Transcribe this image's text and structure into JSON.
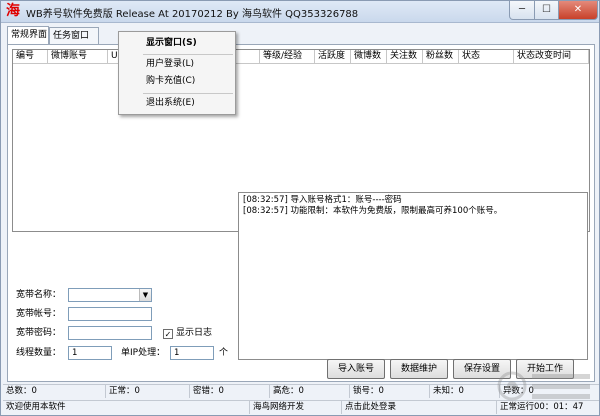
{
  "window": {
    "icon_glyph": "海",
    "title": "WB养号软件免费版 Release At 20170212 By 海鸟软件 QQ353326788",
    "minimize_glyph": "─",
    "maximize_glyph": "☐",
    "close_glyph": "✕"
  },
  "tabs": [
    {
      "label": "常规界面",
      "active": true
    },
    {
      "label": "任务窗口",
      "active": false
    }
  ],
  "table": {
    "columns": [
      "编号",
      "微博账号",
      "U",
      "等级/经验",
      "活跃度",
      "微博数",
      "关注数",
      "粉丝数",
      "状态",
      "状态改变时间"
    ]
  },
  "context_menu": {
    "items": [
      {
        "label": "显示窗口(S)",
        "bold": true
      },
      {
        "label": "用户登录(L)"
      },
      {
        "label": "购卡充值(C)"
      },
      {
        "label": "退出系统(E)"
      }
    ]
  },
  "log": {
    "lines": [
      "[08:32:57] 导入账号格式1：账号----密码",
      "[08:32:57] 功能限制：本软件为免费版，限制最高可养100个账号。"
    ]
  },
  "settings": {
    "broadband_name_label": "宽带名称：",
    "broadband_name_value": "",
    "broadband_account_label": "宽带帐号：",
    "broadband_account_value": "",
    "broadband_password_label": "宽带密码：",
    "broadband_password_value": "",
    "show_log_label": "显示日志",
    "show_log_checked": true,
    "thread_count_label": "线程数量：",
    "thread_count_value": "1",
    "per_ip_label": "单IP处理：",
    "per_ip_value": "1",
    "per_ip_unit": "个"
  },
  "buttons": {
    "import": "导入账号",
    "maintain": "数据维护",
    "save": "保存设置",
    "start": "开始工作"
  },
  "status_counts": [
    "总数：0",
    "正常：0",
    "密错：0",
    "高危：0",
    "锁号：0",
    "未知：0",
    "异数：0"
  ],
  "status_footer": {
    "welcome": "欢迎使用本软件",
    "developer": "海鸟网络开发",
    "login_hint": "点击此处登录",
    "uptime": "正常运行00：01：47"
  }
}
